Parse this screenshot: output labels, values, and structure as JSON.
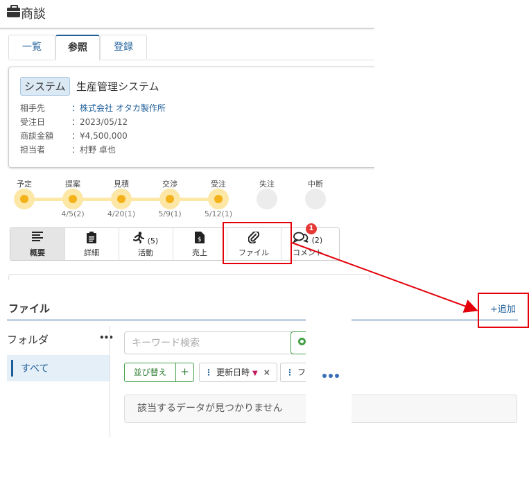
{
  "header": {
    "title": "商談",
    "icon": "briefcase-icon"
  },
  "tabs": [
    {
      "label": "一覧",
      "active": false
    },
    {
      "label": "参照",
      "active": true
    },
    {
      "label": "登録",
      "active": false
    }
  ],
  "deal": {
    "badge": "システム",
    "title": "生産管理システム",
    "fields": [
      {
        "label": "相手先",
        "value": "：株式会社 オタカ製作所",
        "link": true
      },
      {
        "label": "受注日",
        "value": "：2023/05/12",
        "link": false
      },
      {
        "label": "商談金額",
        "value": "：¥4,500,000",
        "link": false
      },
      {
        "label": "担当者",
        "value": "：村野 卓也",
        "link": false
      }
    ]
  },
  "pipeline": {
    "stages": [
      {
        "label": "予定",
        "date": "",
        "active": true
      },
      {
        "label": "提案",
        "date": "4/5(2)",
        "active": true
      },
      {
        "label": "見積",
        "date": "4/20(1)",
        "active": true
      },
      {
        "label": "交渉",
        "date": "5/9(1)",
        "active": true
      },
      {
        "label": "受注",
        "date": "5/12(1)",
        "active": true
      },
      {
        "label": "失注",
        "date": "",
        "active": false
      },
      {
        "label": "中断",
        "date": "",
        "active": false
      }
    ]
  },
  "subtabs": [
    {
      "label": "概要",
      "count": "",
      "icon": "list-icon",
      "active": true
    },
    {
      "label": "詳細",
      "count": "",
      "icon": "clipboard-icon",
      "active": false
    },
    {
      "label": "活動",
      "count": "(5)",
      "icon": "running-icon",
      "active": false
    },
    {
      "label": "売上",
      "count": "",
      "icon": "invoice-icon",
      "active": false
    },
    {
      "label": "ファイル",
      "count": "",
      "icon": "paperclip-icon",
      "active": false
    },
    {
      "label": "コメント",
      "count": "(2)",
      "icon": "comments-icon",
      "active": false
    }
  ],
  "comment_badge": "1",
  "files": {
    "title": "ファイル",
    "add_label": "+追加",
    "folder_title": "フォルダ",
    "folder_menu": "•••",
    "folder_all": "すべて",
    "search_placeholder": "キーワード検索",
    "sort_label": "並び替え",
    "plus": "+",
    "chip_sort": "更新日時",
    "chip_sort_dir": "▼",
    "chip_close": "×",
    "chip_partial": "フ",
    "chip_handle": "⋮",
    "empty_message": "該当するデータが見つかりません"
  },
  "colors": {
    "accent": "#1f5f99",
    "highlight": "#e3000b",
    "progress": "#f3b21a",
    "green": "#43a047"
  }
}
